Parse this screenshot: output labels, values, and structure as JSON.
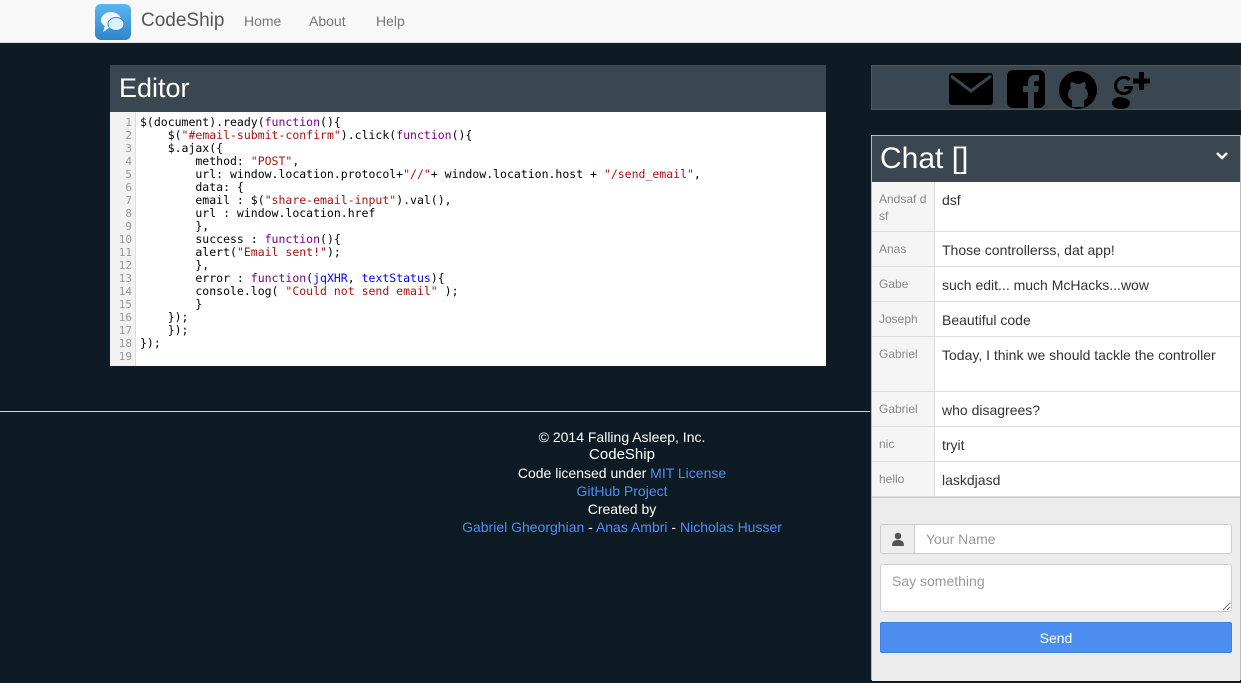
{
  "navbar": {
    "brand": "CodeShip",
    "links": [
      "Home",
      "About",
      "Help"
    ]
  },
  "editor": {
    "title": "Editor",
    "line_numbers": [
      "1",
      "2",
      "3",
      "4",
      "5",
      "6",
      "7",
      "8",
      "9",
      "10",
      "11",
      "12",
      "13",
      "14",
      "15",
      "16",
      "17",
      "18",
      "19"
    ],
    "code": "$(document).ready(function(){\n    $(\"#email-submit-confirm\").click(function(){\n    $.ajax({\n        method: \"POST\",\n        url: window.location.protocol+\"//\"+ window.location.host + \"/send_email\",\n        data: {\n        email : $(\"share-email-input\").val(),\n        url : window.location.href\n        },\n        success : function(){\n        alert(\"Email sent!\");\n        },\n        error : function(jqXHR, textStatus){\n        console.log( \"Could not send email\" );\n        }\n    });\n    });\n});\n"
  },
  "footer": {
    "copyright": "© 2014 Falling Asleep, Inc.",
    "brand": "CodeShip",
    "license_prefix": "Code licensed under ",
    "license_link": "MIT License",
    "github_link": "GitHub Project",
    "created_by": "Created by",
    "authors": [
      "Gabriel Gheorghian",
      "Anas Ambri",
      "Nicholas Husser"
    ],
    "separator": " - "
  },
  "social": {
    "icons": [
      "mail-icon",
      "facebook-icon",
      "github-icon",
      "google-plus-icon"
    ]
  },
  "chat": {
    "title": "Chat []",
    "messages": [
      {
        "name": "Andsaf dsf",
        "text": "dsf"
      },
      {
        "name": "Anas",
        "text": "Those controllerss, dat app!"
      },
      {
        "name": "Gabe",
        "text": "such edit... much McHacks...wow"
      },
      {
        "name": "Joseph",
        "text": "Beautiful code"
      },
      {
        "name": "Gabriel",
        "text": "Today, I think we should tackle the controller"
      },
      {
        "name": "Gabriel",
        "text": "who disagrees?"
      },
      {
        "name": "nic",
        "text": "tryit"
      },
      {
        "name": "hello",
        "text": "laskdjasd"
      }
    ],
    "name_placeholder": "Your Name",
    "message_placeholder": "Say something",
    "send_label": "Send"
  },
  "colors": {
    "background": "#0e1a24",
    "panel_header": "#3a4750",
    "link": "#4d8ff0",
    "send_button": "#4d8ff0"
  }
}
